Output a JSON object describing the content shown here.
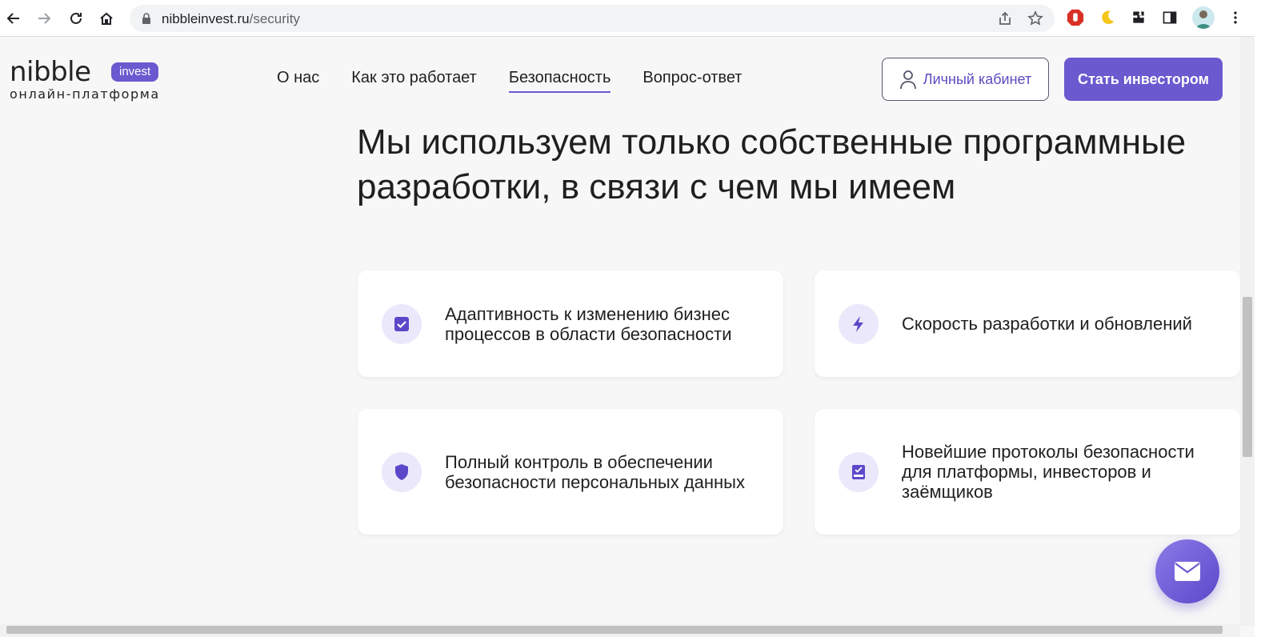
{
  "browser": {
    "url_host": "nibbleinvest.ru",
    "url_path": "/security"
  },
  "site": {
    "logo_word": "nibble",
    "logo_badge": "invest",
    "logo_tagline": "онлайн-платформа",
    "menu": [
      {
        "label": "О нас"
      },
      {
        "label": "Как это работает"
      },
      {
        "label": "Безопасность"
      },
      {
        "label": "Вопрос-ответ"
      }
    ],
    "cabinet_label": "Личный кабинет",
    "invest_label": "Стать инвестором",
    "accent_color": "#6a59cf"
  },
  "main": {
    "headline": "Мы используем только собственные программные разработки, в связи с чем мы имеем",
    "cards": [
      {
        "icon": "check-square-icon",
        "text": "Адаптивность к изменению бизнес процессов в области безопасности"
      },
      {
        "icon": "lightning-icon",
        "text": "Скорость разработки и обновлений"
      },
      {
        "icon": "shield-icon",
        "text": "Полный контроль в обеспечении безопасности персональных данных"
      },
      {
        "icon": "document-icon",
        "text": "Новейшие протоколы безопасности для платформы, инвесторов и заёмщиков"
      }
    ]
  }
}
